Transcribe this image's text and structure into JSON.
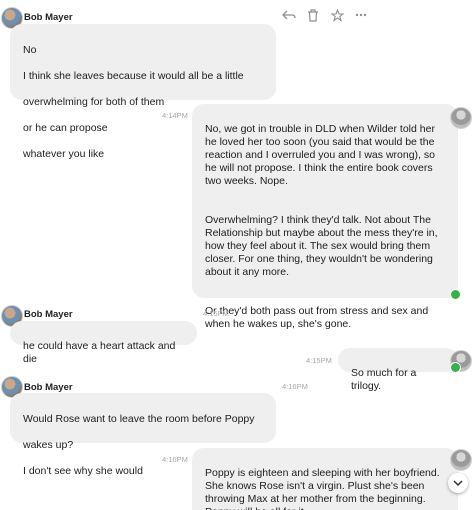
{
  "toolbar": {
    "icons": [
      "reply-icon",
      "trash-icon",
      "star-icon",
      "more-icon"
    ]
  },
  "messages": [
    {
      "sender": "Bob Mayer",
      "lines": [
        "No",
        "I think she leaves because it would all be a little",
        "overwhelming for both of them",
        "or he can propose",
        "whatever you like"
      ]
    },
    {
      "time": "4:14PM",
      "paragraphs": [
        "No, we got in trouble in DLD when Wilder told her he loved her too soon (you said that would be the reaction and I overruled you and I was wrong), so he will not propose.  I think the entire book covers two weeks.  Nope.",
        "Overwhelming?  I think they'd talk.  Not about The Relationship but maybe about the mess they're in, how they feel about it.  The sex would bring them closer.  For one thing, they wouldn't be wondering about it any more.",
        "Or they'd both pass out from stress and sex and when he wakes up, she's gone."
      ]
    },
    {
      "sender": "Bob Mayer",
      "time": "4:15PM",
      "text": "he could have a heart attack and die"
    },
    {
      "time": "4:15PM",
      "text": "So much for a trilogy."
    },
    {
      "sender": "Bob Mayer",
      "time": "4:16PM",
      "lines": [
        "Would Rose want to leave the room before Poppy",
        "wakes up?",
        "I don't see why she would"
      ]
    },
    {
      "time": "4:16PM",
      "text": "Poppy is eighteen and sleeping with her boyfriend. She knows Rose isn't a virgin.  Plust she's been throwing Max at her mother from the beginning. Poppy will be all for it."
    }
  ]
}
